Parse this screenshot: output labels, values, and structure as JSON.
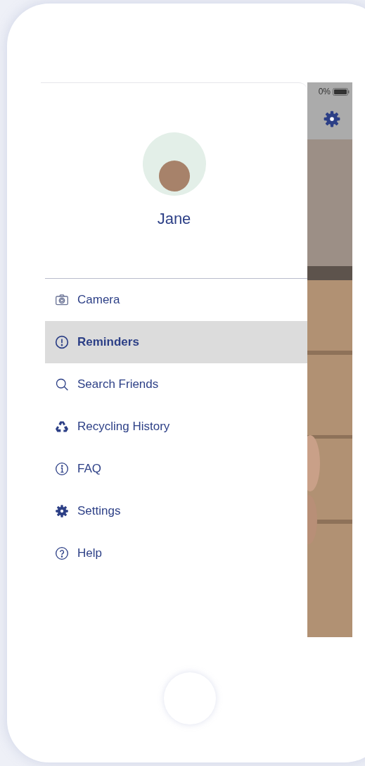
{
  "user": {
    "name": "Jane"
  },
  "status_bar": {
    "battery": "0%"
  },
  "menu": [
    {
      "kind": "camera",
      "label": "Camera",
      "selected": false
    },
    {
      "kind": "alert",
      "label": "Reminders",
      "selected": true
    },
    {
      "kind": "search",
      "label": "Search Friends",
      "selected": false
    },
    {
      "kind": "recycle",
      "label": "Recycling History",
      "selected": false
    },
    {
      "kind": "info",
      "label": "FAQ",
      "selected": false
    },
    {
      "kind": "gear",
      "label": "Settings",
      "selected": false
    },
    {
      "kind": "help",
      "label": "Help",
      "selected": false
    }
  ]
}
